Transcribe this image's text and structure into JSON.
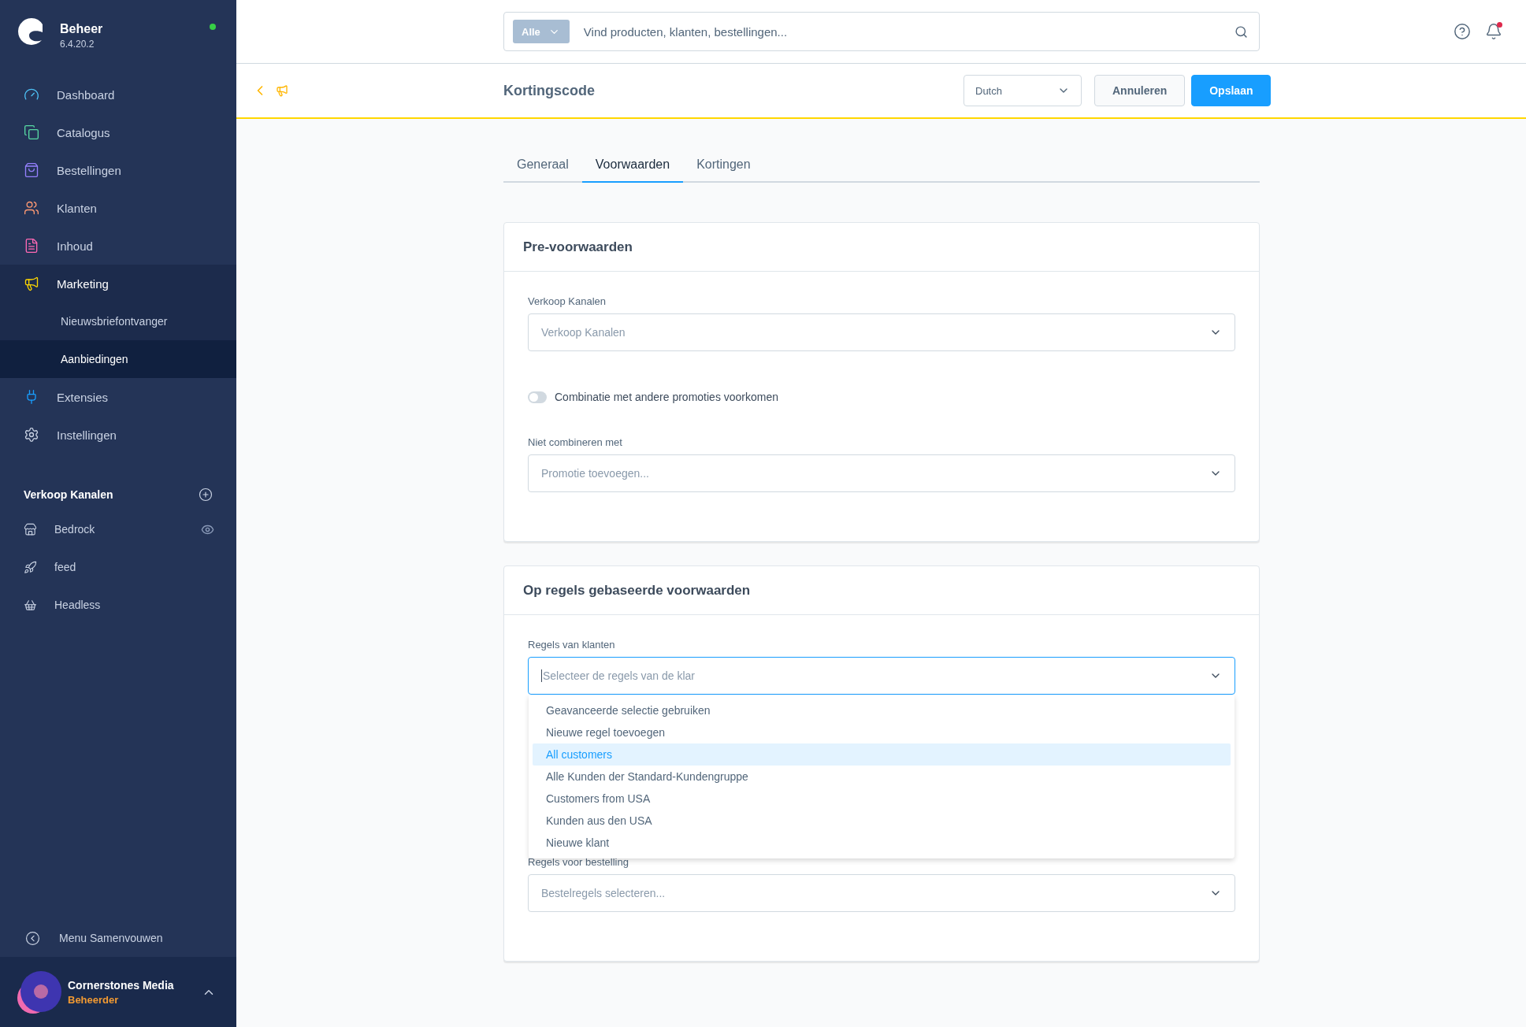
{
  "sidebar": {
    "brand": {
      "title": "Beheer",
      "version": "6.4.20.2",
      "online": true
    },
    "nav": [
      {
        "label": "Dashboard",
        "kind": "gauge",
        "selected": false
      },
      {
        "label": "Catalogus",
        "kind": "copy",
        "selected": false
      },
      {
        "label": "Bestellingen",
        "kind": "bag",
        "selected": false
      },
      {
        "label": "Klanten",
        "kind": "users",
        "selected": false
      },
      {
        "label": "Inhoud",
        "kind": "content",
        "selected": false
      },
      {
        "label": "Marketing",
        "kind": "megaphone",
        "selected": false,
        "expanded": true,
        "children": [
          {
            "label": "Nieuwsbriefontvanger",
            "selected": false
          },
          {
            "label": "Aanbiedingen",
            "selected": true
          }
        ]
      },
      {
        "label": "Extensies",
        "kind": "plug",
        "selected": false
      },
      {
        "label": "Instellingen",
        "kind": "gear",
        "selected": false
      }
    ],
    "sales_channels": {
      "title": "Verkoop Kanalen",
      "items": [
        {
          "label": "Bedrock",
          "kind": "store",
          "preview": true
        },
        {
          "label": "feed",
          "kind": "rocket",
          "preview": false
        },
        {
          "label": "Headless",
          "kind": "basket",
          "preview": false
        }
      ]
    },
    "collapse": "Menu Samenvouwen",
    "user": {
      "name": "Cornerstones Media",
      "role": "Beheerder"
    }
  },
  "search": {
    "scope": "Alle",
    "placeholder": "Vind producten, klanten, bestellingen..."
  },
  "notifications": {
    "unread": true
  },
  "toolbar": {
    "title": "Kortingscode",
    "language": "Dutch",
    "buttons": [
      {
        "label": "Annuleren",
        "kind": "secondary"
      },
      {
        "label": "Opslaan",
        "kind": "primary"
      }
    ]
  },
  "tabs": [
    {
      "label": "Generaal",
      "selected": false
    },
    {
      "label": "Voorwaarden",
      "selected": true
    },
    {
      "label": "Kortingen",
      "selected": false
    }
  ],
  "cards": [
    {
      "title": "Pre-voorwaarden",
      "fields": [
        {
          "kind": "select",
          "label": "Verkoop Kanalen",
          "placeholder": "Verkoop Kanalen"
        },
        {
          "kind": "toggle",
          "label": "Combinatie met andere promoties voorkomen",
          "on": false
        },
        {
          "kind": "select",
          "label": "Niet combineren met",
          "placeholder": "Promotie toevoegen..."
        }
      ]
    },
    {
      "title": "Op regels gebaseerde voorwaarden",
      "fields": [
        {
          "kind": "select",
          "label": "Regels van klanten",
          "placeholder": "Selecteer de regels van de klar",
          "focused": true,
          "open": true,
          "options": [
            {
              "label": "Geavanceerde selectie gebruiken",
              "selected": false
            },
            {
              "label": "Nieuwe regel toevoegen",
              "selected": false
            },
            {
              "label": "All customers",
              "selected": true
            },
            {
              "label": "Alle Kunden der Standard-Kundengruppe",
              "selected": false
            },
            {
              "label": "Customers from USA",
              "selected": false
            },
            {
              "label": "Kunden aus den USA",
              "selected": false
            },
            {
              "label": "Nieuwe klant",
              "selected": false
            }
          ]
        },
        {
          "kind": "select",
          "label": "Regels voor bestelling",
          "placeholder": "Bestelregels selecteren..."
        }
      ]
    }
  ]
}
